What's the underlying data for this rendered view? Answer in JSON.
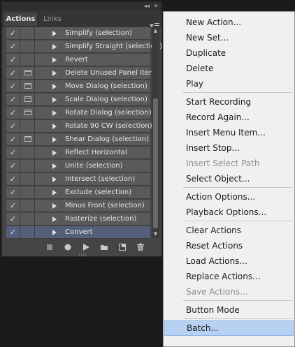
{
  "panel": {
    "tabs": [
      "Actions",
      "Links"
    ],
    "collapse_glyph": "◂◂",
    "close_glyph": "✕",
    "rows": [
      {
        "label": "Simplify (selection)",
        "checked": true,
        "dialog": false,
        "selected": false
      },
      {
        "label": "Simplify Straight (selection)",
        "checked": true,
        "dialog": false,
        "selected": false
      },
      {
        "label": "Revert",
        "checked": true,
        "dialog": false,
        "selected": false
      },
      {
        "label": "Delete Unused Panel Items",
        "checked": true,
        "dialog": true,
        "selected": false
      },
      {
        "label": "Move Dialog (selection)",
        "checked": true,
        "dialog": true,
        "selected": false
      },
      {
        "label": "Scale Dialog (selection)",
        "checked": true,
        "dialog": true,
        "selected": false
      },
      {
        "label": "Rotate Dialog (selection)",
        "checked": true,
        "dialog": true,
        "selected": false
      },
      {
        "label": "Rotate 90 CW (selection)",
        "checked": true,
        "dialog": false,
        "selected": false
      },
      {
        "label": "Shear Dialog (selection)",
        "checked": true,
        "dialog": true,
        "selected": false
      },
      {
        "label": "Reflect Horizontal",
        "checked": true,
        "dialog": false,
        "selected": false
      },
      {
        "label": "Unite (selection)",
        "checked": true,
        "dialog": false,
        "selected": false
      },
      {
        "label": "Intersect (selection)",
        "checked": true,
        "dialog": false,
        "selected": false
      },
      {
        "label": "Exclude (selection)",
        "checked": true,
        "dialog": false,
        "selected": false
      },
      {
        "label": "Minus Front (selection)",
        "checked": true,
        "dialog": false,
        "selected": false
      },
      {
        "label": "Rasterize (selection)",
        "checked": true,
        "dialog": false,
        "selected": false
      },
      {
        "label": "Convert",
        "checked": true,
        "dialog": false,
        "selected": true
      }
    ],
    "check_glyph": "✓",
    "toolbar_icons": [
      "stop-icon",
      "record-icon",
      "play-icon",
      "new-set-icon",
      "new-action-icon",
      "trash-icon"
    ]
  },
  "menu": {
    "groups": [
      [
        {
          "label": "New Action...",
          "enabled": true
        },
        {
          "label": "New Set...",
          "enabled": true
        },
        {
          "label": "Duplicate",
          "enabled": true
        },
        {
          "label": "Delete",
          "enabled": true
        },
        {
          "label": "Play",
          "enabled": true
        }
      ],
      [
        {
          "label": "Start Recording",
          "enabled": true
        },
        {
          "label": "Record Again...",
          "enabled": true
        },
        {
          "label": "Insert Menu Item...",
          "enabled": true
        },
        {
          "label": "Insert Stop...",
          "enabled": true
        },
        {
          "label": "Insert Select Path",
          "enabled": false
        },
        {
          "label": "Select Object...",
          "enabled": true
        }
      ],
      [
        {
          "label": "Action Options...",
          "enabled": true
        },
        {
          "label": "Playback Options...",
          "enabled": true
        }
      ],
      [
        {
          "label": "Clear Actions",
          "enabled": true
        },
        {
          "label": "Reset Actions",
          "enabled": true
        },
        {
          "label": "Load Actions...",
          "enabled": true
        },
        {
          "label": "Replace Actions...",
          "enabled": true
        },
        {
          "label": "Save Actions...",
          "enabled": false
        }
      ],
      [
        {
          "label": "Button Mode",
          "enabled": true
        }
      ],
      [
        {
          "label": "Batch...",
          "enabled": true,
          "highlighted": true
        }
      ]
    ]
  },
  "colors": {
    "selected_row": "#54607a",
    "menu_highlight": "#b7d1f2"
  }
}
